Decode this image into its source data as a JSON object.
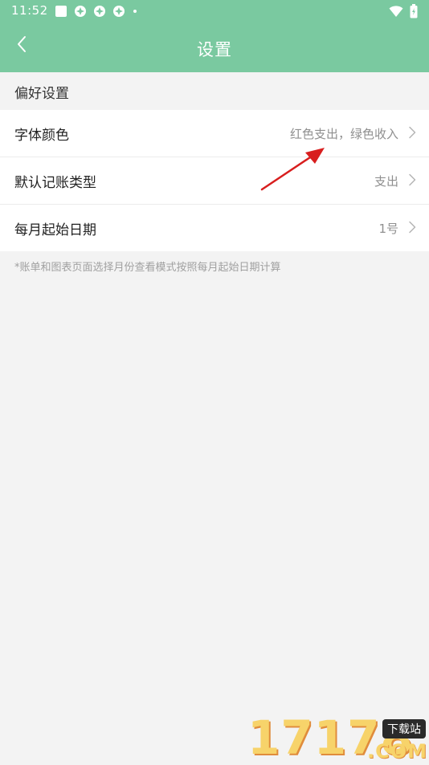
{
  "status_bar": {
    "time": "11:52"
  },
  "nav": {
    "title": "设置"
  },
  "section": {
    "title": "偏好设置"
  },
  "rows": [
    {
      "label": "字体颜色",
      "value": "红色支出，绿色收入"
    },
    {
      "label": "默认记账类型",
      "value": "支出"
    },
    {
      "label": "每月起始日期",
      "value": "1号"
    }
  ],
  "note": "*账单和图表页面选择月份查看模式按照每月起始日期计算",
  "watermark": {
    "number": "17178",
    "tag": "下载站",
    "suffix": ".COM"
  },
  "colors": {
    "header": "#7ac9a0",
    "background": "#f3f3f3",
    "arrow": "#d81e1e"
  },
  "icons": {
    "back": "chevron-left-icon",
    "row_chevron": "chevron-right-icon",
    "wifi": "wifi-icon",
    "battery": "battery-icon"
  }
}
